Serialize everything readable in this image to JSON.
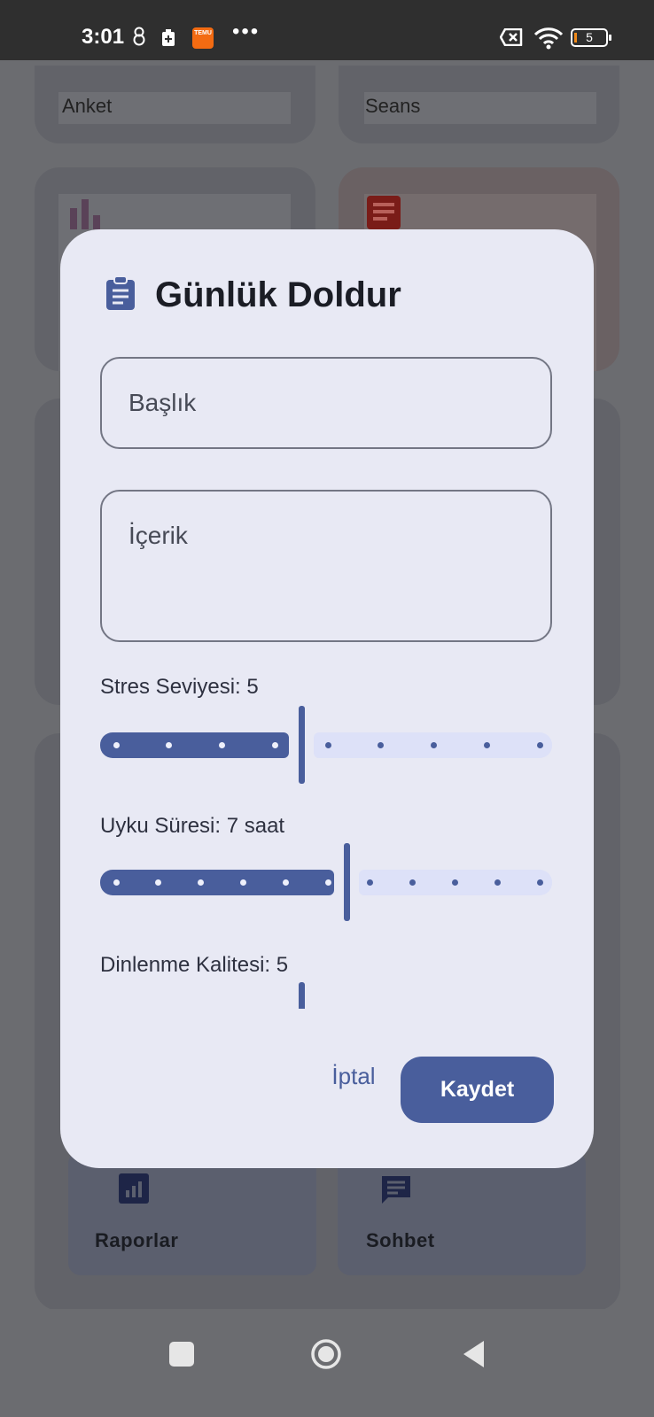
{
  "status_bar": {
    "time": "3:01",
    "battery": "5",
    "icons": [
      "snowman-icon",
      "battery-saver-icon",
      "temu-app-icon",
      "more-dots-icon",
      "no-sim-icon",
      "wifi-icon",
      "battery-icon"
    ],
    "temu_label": "TEMU"
  },
  "background_app": {
    "card_labels": [
      "Anket",
      "Seans"
    ],
    "bottom_tiles": [
      {
        "label": "Raporlar",
        "icon": "bar-chart-icon"
      },
      {
        "label": "Sohbet",
        "icon": "chat-icon"
      }
    ]
  },
  "dialog": {
    "icon": "clipboard-icon",
    "title": "Günlük Doldur",
    "title_field_placeholder": "Başlık",
    "content_field_placeholder": "İçerik",
    "sliders": [
      {
        "label": "Stres Seviyesi: 5",
        "value": 5,
        "min": 1,
        "max": 10
      },
      {
        "label": "Uyku Süresi: 7 saat",
        "value": 7,
        "min": 1,
        "max": 12
      },
      {
        "label": "Dinlenme Kalitesi: 5",
        "value": 5,
        "min": 1,
        "max": 10
      }
    ],
    "cancel_label": "İptal",
    "save_label": "Kaydet"
  },
  "colors": {
    "accent": "#495e9c",
    "dialog_bg": "#e8e9f4",
    "track_inactive": "#dde1f8",
    "scrim": "#6b6c70"
  }
}
